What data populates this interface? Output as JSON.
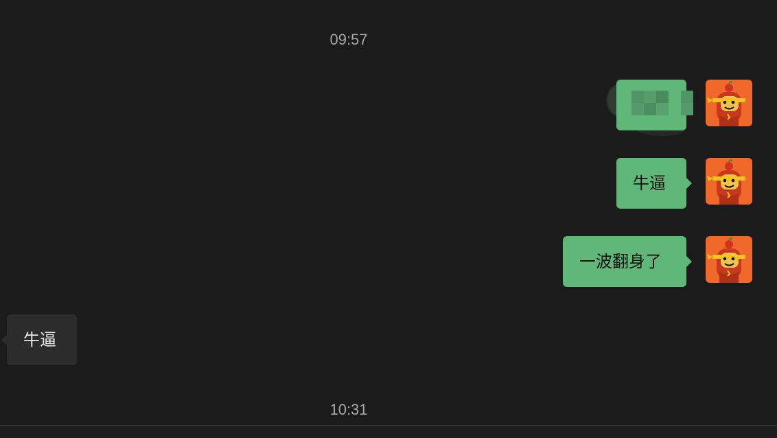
{
  "chat": {
    "timestamps": [
      "09:57",
      "10:31"
    ],
    "messages": [
      {
        "direction": "outgoing",
        "type": "sticker",
        "content": ""
      },
      {
        "direction": "outgoing",
        "type": "text",
        "text": "牛逼"
      },
      {
        "direction": "outgoing",
        "type": "text",
        "text": "一波翻身了"
      },
      {
        "direction": "incoming",
        "type": "text",
        "text": "牛逼"
      }
    ]
  },
  "colors": {
    "background": "#1b1b1b",
    "outgoing_bubble": "#5fb878",
    "incoming_bubble": "#2c2c2c",
    "avatar_bg": "#f0682a",
    "timestamp_text": "#a8a8a8"
  },
  "icons": {
    "avatar": "cartoon-ninja-avatar-icon"
  }
}
